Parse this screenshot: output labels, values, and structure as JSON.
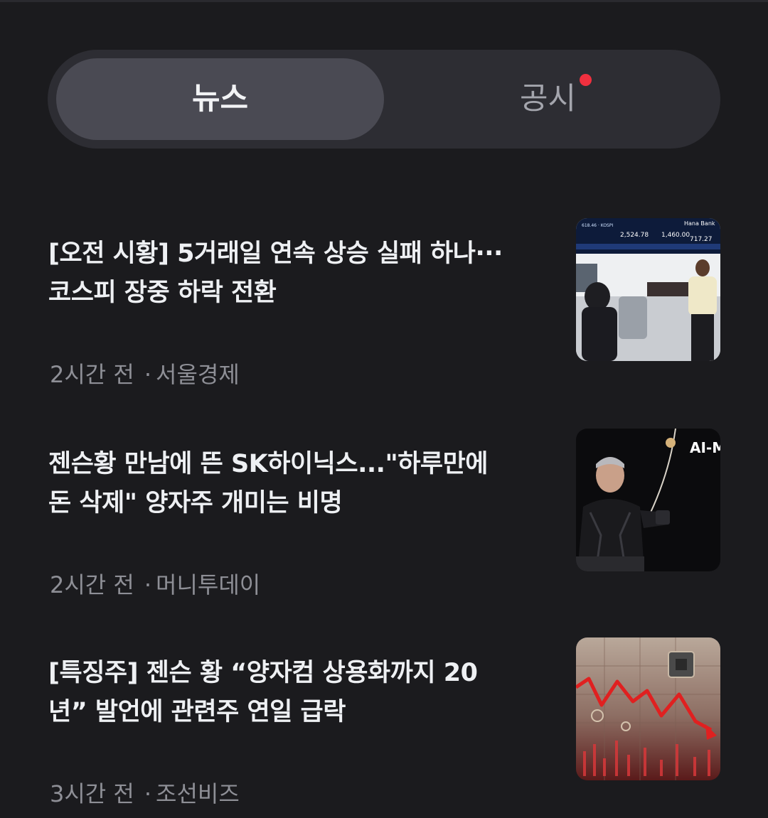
{
  "tabs": {
    "news_label": "뉴스",
    "disclosure_label": "공시"
  },
  "articles": [
    {
      "headline": "[오전 시황] 5거래일 연속 상승 실패 하나···코스피 장중 하락 전환",
      "time": "2시간 전",
      "source": "서울경제",
      "thumbnail": {
        "icon": "stock-exchange-photo",
        "board_text_1": "2,524.78",
        "board_text_2": "1,460.00",
        "board_text_3": "717.27",
        "bank_text": "Hana Bank"
      }
    },
    {
      "headline": "젠슨황 만남에 뜬 SK하이닉스...\"하루만에 돈 삭제\" 양자주 개미는 비명",
      "time": "2시간 전",
      "source": "머니투데이",
      "thumbnail": {
        "icon": "speaker-on-stage-photo",
        "stage_text": "AI-M"
      }
    },
    {
      "headline": "[특징주] 젠슨 황 “양자컴 상용화까지 20년” 발언에 관련주 연일 급락",
      "time": "3시간 전",
      "source": "조선비즈",
      "thumbnail": {
        "icon": "falling-chart-illustration"
      }
    }
  ],
  "colors": {
    "background": "#1b1b1e",
    "segment_bg": "#2d2d33",
    "segment_active": "#4a4a53",
    "notification_dot": "#f0303f",
    "meta_text": "#8e8f96"
  }
}
